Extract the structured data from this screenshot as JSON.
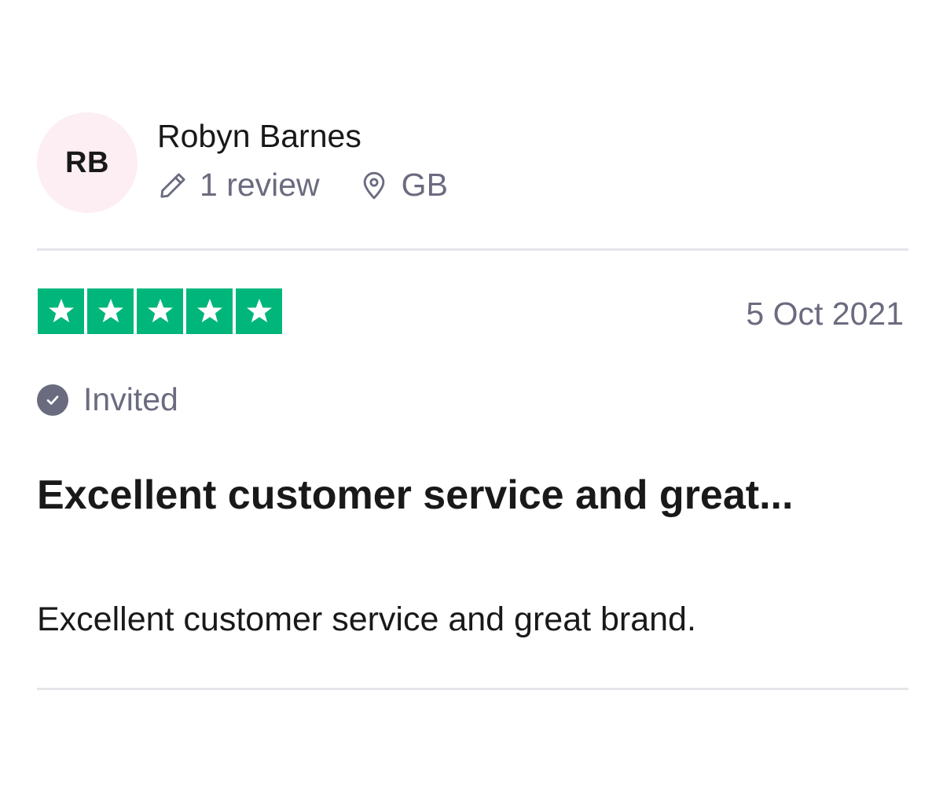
{
  "reviewer": {
    "initials": "RB",
    "name": "Robyn Barnes",
    "review_count": "1 review",
    "country": "GB"
  },
  "rating": {
    "stars": 5,
    "max_stars": 5,
    "color": "#00b67a"
  },
  "date": "5 Oct 2021",
  "invited_label": "Invited",
  "review": {
    "title": "Excellent customer service and great...",
    "body": "Excellent customer service and great brand."
  },
  "icons": {
    "pencil": "pencil-icon",
    "location": "location-pin-icon",
    "verified": "checkmark-circle-icon",
    "star": "star-icon"
  },
  "colors": {
    "avatar_bg": "#fdeef3",
    "muted_text": "#6b6b80",
    "divider": "#e5e5ea"
  }
}
